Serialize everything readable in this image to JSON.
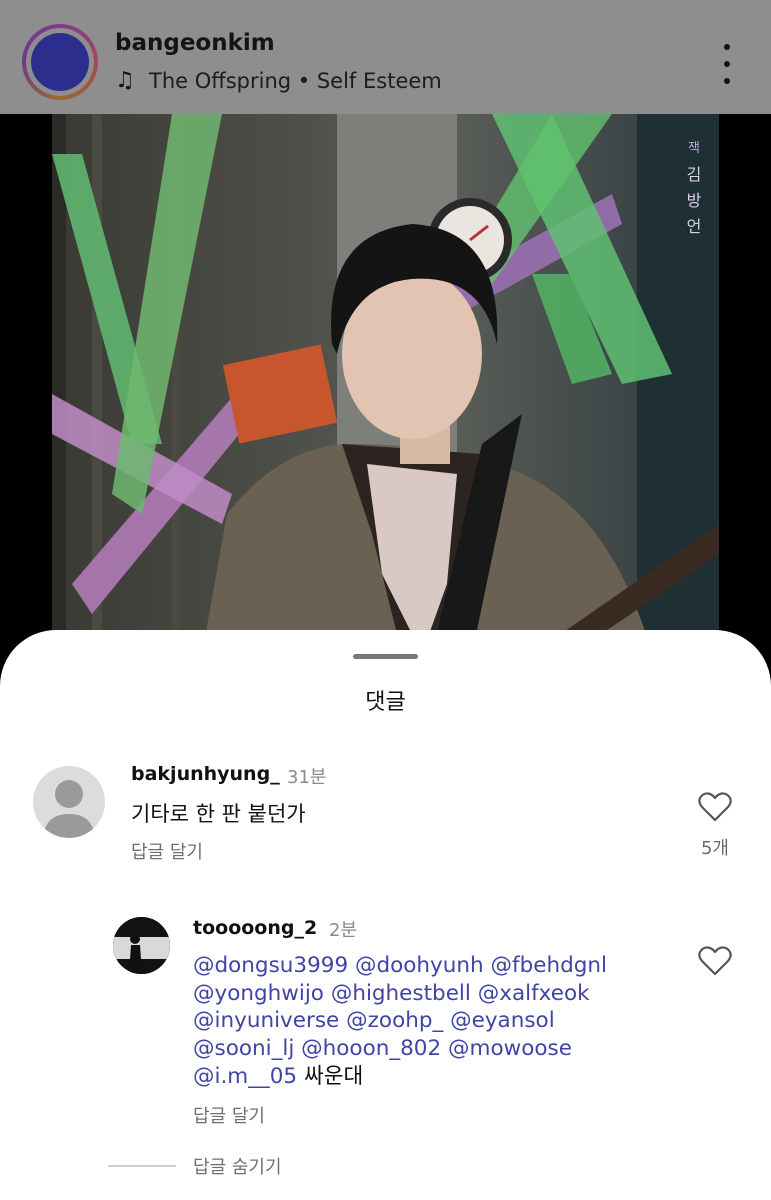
{
  "header": {
    "username": "bangeonkim",
    "music_icon": "music-note-icon",
    "track": "The Offspring • Self Esteem",
    "more_icon": "more-vertical-icon"
  },
  "photo": {
    "poster_text": [
      "잭",
      "김",
      "방",
      "언"
    ]
  },
  "sheet": {
    "title": "댓글",
    "comment": {
      "username": "bakjunhyung_",
      "time": "31분",
      "text": "기타로 한 판 붙던가",
      "reply_label": "답글 달기",
      "like_icon": "heart-outline-icon",
      "like_count": "5개"
    },
    "reply": {
      "username": "tooooong_2",
      "time": "2분",
      "lines": [
        {
          "mentions": [
            "@dongsu3999",
            "@doohyunh",
            "@fbehdgnl"
          ],
          "tail": ""
        },
        {
          "mentions": [
            "@yonghwijo",
            "@highestbell",
            "@xalfxeok"
          ],
          "tail": ""
        },
        {
          "mentions": [
            "@inyuniverse",
            "@zoohp_",
            "@eyansol"
          ],
          "tail": ""
        },
        {
          "mentions": [
            "@sooni_lj",
            "@hooon_802",
            "@mowoose"
          ],
          "tail": ""
        },
        {
          "mentions": [
            "@i.m__05"
          ],
          "tail": "싸운대"
        }
      ],
      "reply_label": "답글 달기",
      "like_icon": "heart-outline-icon",
      "hide_label": "답글 숨기기"
    }
  }
}
